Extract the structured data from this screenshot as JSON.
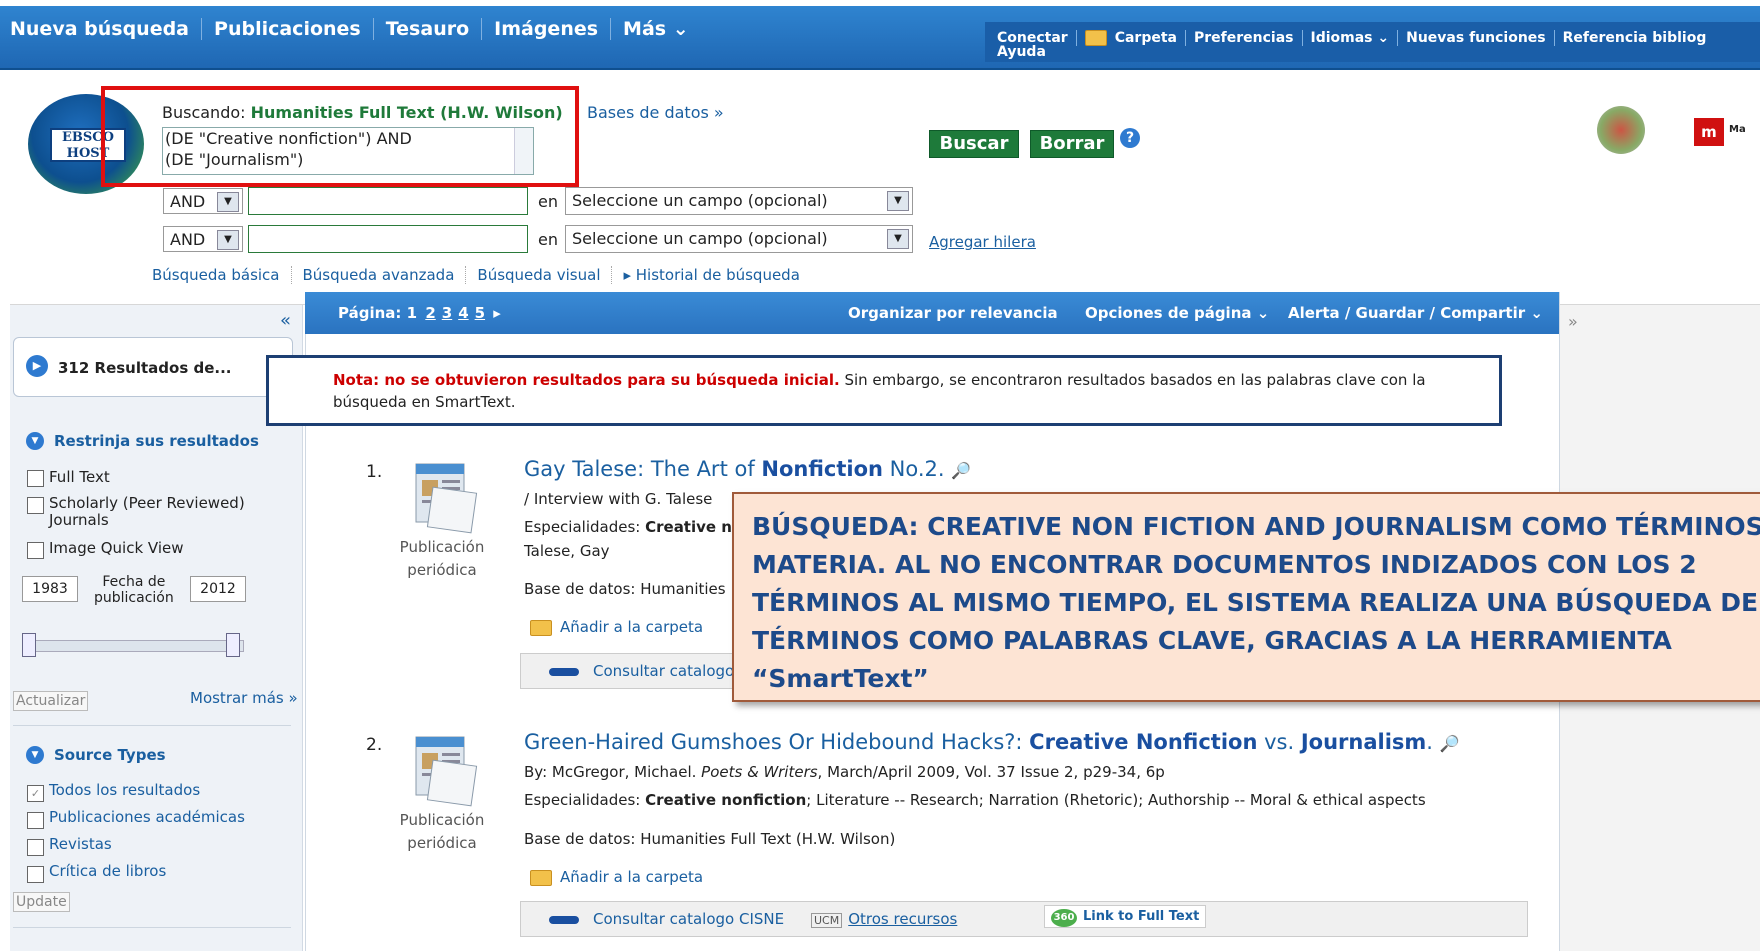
{
  "topnav": {
    "items": [
      "Nueva búsqueda",
      "Publicaciones",
      "Tesauro",
      "Imágenes",
      "Más ⌄"
    ],
    "right_links": [
      "Conectar",
      "Carpeta",
      "Preferencias",
      "Idiomas ⌄",
      "Nuevas funciones",
      "Referencia bibliog"
    ],
    "help": "Ayuda"
  },
  "logo": {
    "text": "EBSCO HOST"
  },
  "search": {
    "searching_label": "Buscando:",
    "database": "Humanities Full Text (H.W. Wilson)",
    "databases_link": "Bases de datos »",
    "query_line1": "(DE \"Creative nonfiction\")  AND",
    "query_line2": "(DE \"Journalism\")",
    "search_button": "Buscar",
    "clear_button": "Borrar",
    "help_icon": "?",
    "rows": [
      {
        "bool": "AND",
        "en": "en",
        "field": "Seleccione un campo (opcional)"
      },
      {
        "bool": "AND",
        "en": "en",
        "field": "Seleccione un campo (opcional)"
      }
    ],
    "add_row": "Agregar hilera",
    "subnav": [
      "Búsqueda básica",
      "Búsqueda avanzada",
      "Búsqueda visual",
      "▸ Historial de búsqueda"
    ]
  },
  "branding": {
    "madrid_mark": "m",
    "madrid_text": "Ma"
  },
  "sidebar": {
    "collapse": "«",
    "results_count": "312 Resultados de...",
    "refine_title": "Restrinja sus resultados",
    "filters": [
      "Full Text",
      "Scholarly (Peer Reviewed)",
      "Journals",
      "Image Quick View"
    ],
    "year_from": "1983",
    "date_label_1": "Fecha de",
    "date_label_2": "publicación",
    "year_to": "2012",
    "update_button": "Actualizar",
    "show_more": "Mostrar más »",
    "source_title": "Source Types",
    "sources": [
      "Todos los resultados",
      "Publicaciones académicas",
      "Revistas",
      "Crítica de libros"
    ],
    "update_button_2": "Update"
  },
  "results_bar": {
    "page_label": "Página:",
    "pages": [
      "1",
      "2",
      "3",
      "4",
      "5"
    ],
    "next_arrow": "▸",
    "sort": "Organizar por relevancia",
    "page_options": "Opciones de página ⌄",
    "alert": "Alerta / Guardar / Compartir ⌄",
    "collapse_right": "»"
  },
  "note": {
    "bold": "Nota: no se obtuvieron resultados para su búsqueda inicial.",
    "rest": " Sin embargo, se encontraron resultados basados en las palabras clave con la búsqueda en SmartText."
  },
  "results": [
    {
      "num": "1.",
      "type_1": "Publicación",
      "type_2": "periódica",
      "title_a": "Gay Talese: The Art of ",
      "title_b": "Nonfiction",
      "title_c": " No.2.",
      "byline": "/ Interview with G. Talese",
      "subjects_label": "Especialidades:",
      "subjects": "Creative n",
      "author": "Talese, Gay",
      "database": "Base de datos: Humanities",
      "add_folder": "Añadir a la carpeta",
      "cisne": "Consultar catalogo"
    },
    {
      "num": "2.",
      "type_1": "Publicación",
      "type_2": "periódica",
      "title_a": "Green-Haired Gumshoes Or Hidebound Hacks?: ",
      "title_b": "Creative Nonfiction",
      "title_c": " vs. ",
      "title_d": "Journalism",
      "title_e": ".",
      "byline_by": "By: McGregor, Michael. ",
      "byline_pub": "Poets & Writers",
      "byline_rest": ", March/April 2009, Vol. 37 Issue 2, p29-34, 6p",
      "subjects_label": "Especialidades:",
      "subjects_bold": "Creative nonfiction",
      "subjects_rest": "; Literature -- Research; Narration (Rhetoric); Authorship -- Moral & ethical aspects",
      "database": "Base de datos: Humanities Full Text (H.W. Wilson)",
      "add_folder": "Añadir a la carpeta",
      "cisne": "Consultar catalogo CISNE",
      "ucm": "UCM",
      "other": "Otros recursos",
      "fulltext_icon": "360",
      "fulltext": "Link to Full Text"
    }
  ],
  "callout": {
    "lines": [
      "BÚSQUEDA: CREATIVE NON FICTION AND JOURNALISM COMO TÉRMINOS D",
      "MATERIA. AL NO ENCONTRAR DOCUMENTOS INDIZADOS CON LOS 2",
      "TÉRMINOS AL MISMO TIEMPO, EL SISTEMA REALIZA UNA BÚSQUEDA DE ES",
      "TÉRMINOS COMO PALABRAS CLAVE, GRACIAS A LA HERRAMIENTA",
      "“SmartText”"
    ]
  },
  "colors": {
    "accent": "#2a73c0",
    "green": "#1e7a3a",
    "highlight_red": "#e01010",
    "note_border": "#1d3f73"
  }
}
